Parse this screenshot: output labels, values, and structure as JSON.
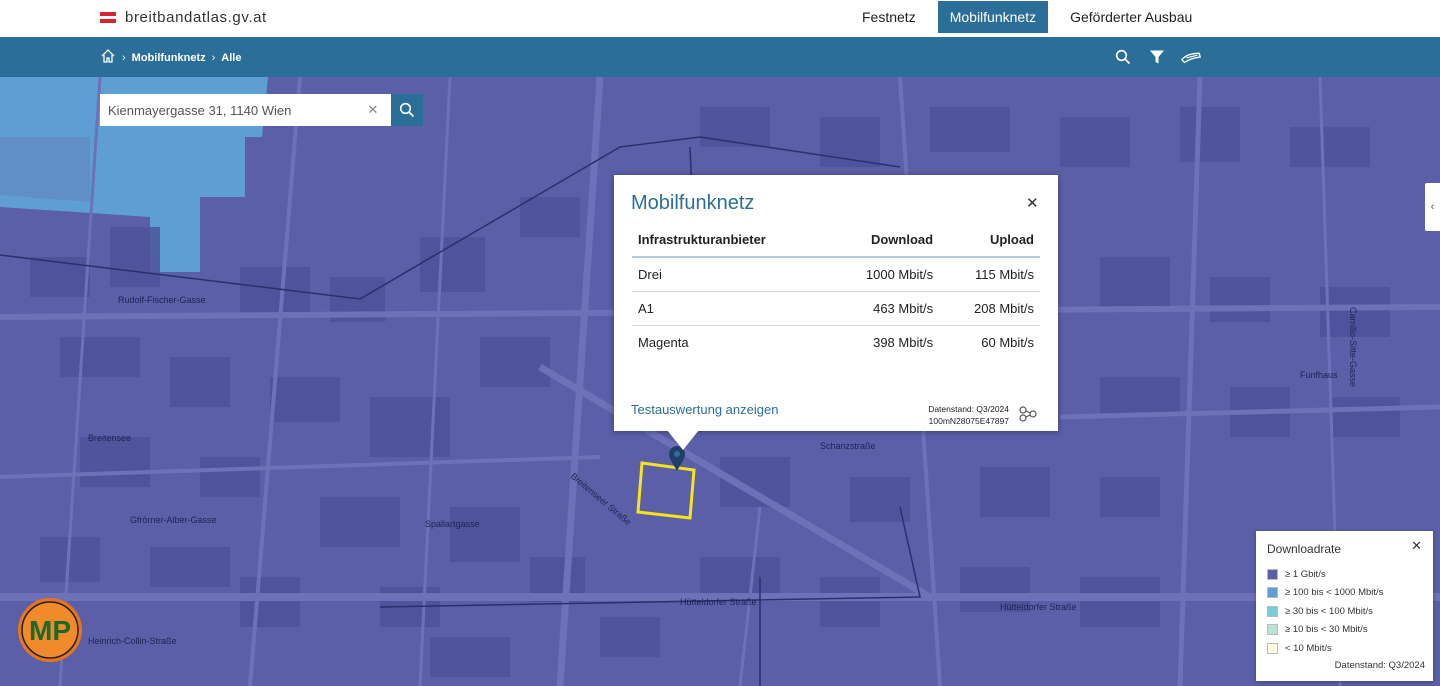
{
  "site": {
    "title": "breitbandatlas.gv.at",
    "flag_colors": [
      "#d7262f",
      "#ffffff",
      "#d7262f"
    ]
  },
  "top_nav": [
    {
      "label": "Festnetz",
      "active": false
    },
    {
      "label": "Mobilfunknetz",
      "active": true
    },
    {
      "label": "Geförderter Ausbau",
      "active": false
    }
  ],
  "breadcrumb": {
    "home_icon": "home-icon",
    "items": [
      "Mobilfunknetz",
      "Alle"
    ]
  },
  "tools": [
    "search-icon",
    "filter-icon",
    "layers-icon"
  ],
  "search": {
    "value": "Kienmayergasse 31, 1140 Wien",
    "placeholder": ""
  },
  "popup": {
    "title": "Mobilfunknetz",
    "columns": [
      "Infrastrukturanbieter",
      "Download",
      "Upload"
    ],
    "rows": [
      {
        "provider": "Drei",
        "download": "1000 Mbit/s",
        "upload": "115 Mbit/s"
      },
      {
        "provider": "A1",
        "download": "463 Mbit/s",
        "upload": "208 Mbit/s"
      },
      {
        "provider": "Magenta",
        "download": "398 Mbit/s",
        "upload": "60 Mbit/s"
      }
    ],
    "link": "Testauswertung anzeigen",
    "datenstand": "Datenstand: Q3/2024",
    "cell_id": "100mN28075E47897"
  },
  "legend": {
    "title": "Downloadrate",
    "items": [
      {
        "label": "≥ 1 Gbit/s",
        "color": "#5a5fa8"
      },
      {
        "label": "≥ 100 bis < 1000 Mbit/s",
        "color": "#5e9ed2"
      },
      {
        "label": "≥ 30 bis < 100 Mbit/s",
        "color": "#7ccbdc"
      },
      {
        "label": "≥ 10 bis < 30 Mbit/s",
        "color": "#b8e2d2"
      },
      {
        "label": "< 10 Mbit/s",
        "color": "#fffbe0"
      }
    ],
    "datenstand": "Datenstand: Q3/2024"
  },
  "map_labels": [
    "Breitensee",
    "Hütteldorfer Straße",
    "Spallartgasse",
    "Gfrörner-Alber-Gasse",
    "Rudolf-Fischer-Gasse",
    "Heinrich-Collin-Straße",
    "Schanzstraße",
    "Funfhaus",
    "Camillo-Sitte-Gasse",
    "Hütteldorfer Straße",
    "Breitenseer Straße"
  ],
  "logo": {
    "text": "MP",
    "ring_color": "#e8741e"
  }
}
